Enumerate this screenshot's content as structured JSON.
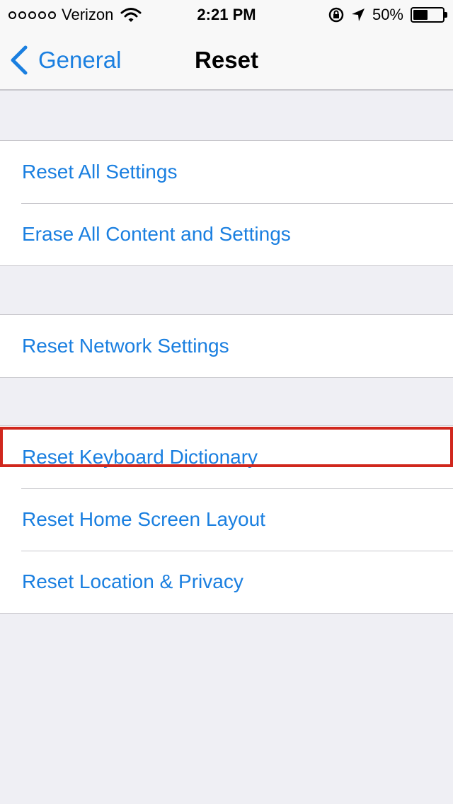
{
  "status_bar": {
    "carrier": "Verizon",
    "time": "2:21 PM",
    "battery_percent": "50%",
    "battery_level": 0.5,
    "icons": [
      "signal-dots-icon",
      "wifi-icon",
      "rotation-lock-icon",
      "location-arrow-icon",
      "battery-icon"
    ]
  },
  "nav": {
    "back_label": "General",
    "title": "Reset"
  },
  "groups": [
    {
      "items": [
        {
          "label": "Reset All Settings"
        },
        {
          "label": "Erase All Content and Settings"
        }
      ]
    },
    {
      "items": [
        {
          "label": "Reset Network Settings"
        }
      ]
    },
    {
      "items": [
        {
          "label": "Reset Keyboard Dictionary",
          "highlighted": true
        },
        {
          "label": "Reset Home Screen Layout"
        },
        {
          "label": "Reset Location & Privacy"
        }
      ]
    }
  ],
  "colors": {
    "accent": "#1a7fe0",
    "highlight_box": "#d0271d",
    "background": "#efeff4"
  }
}
